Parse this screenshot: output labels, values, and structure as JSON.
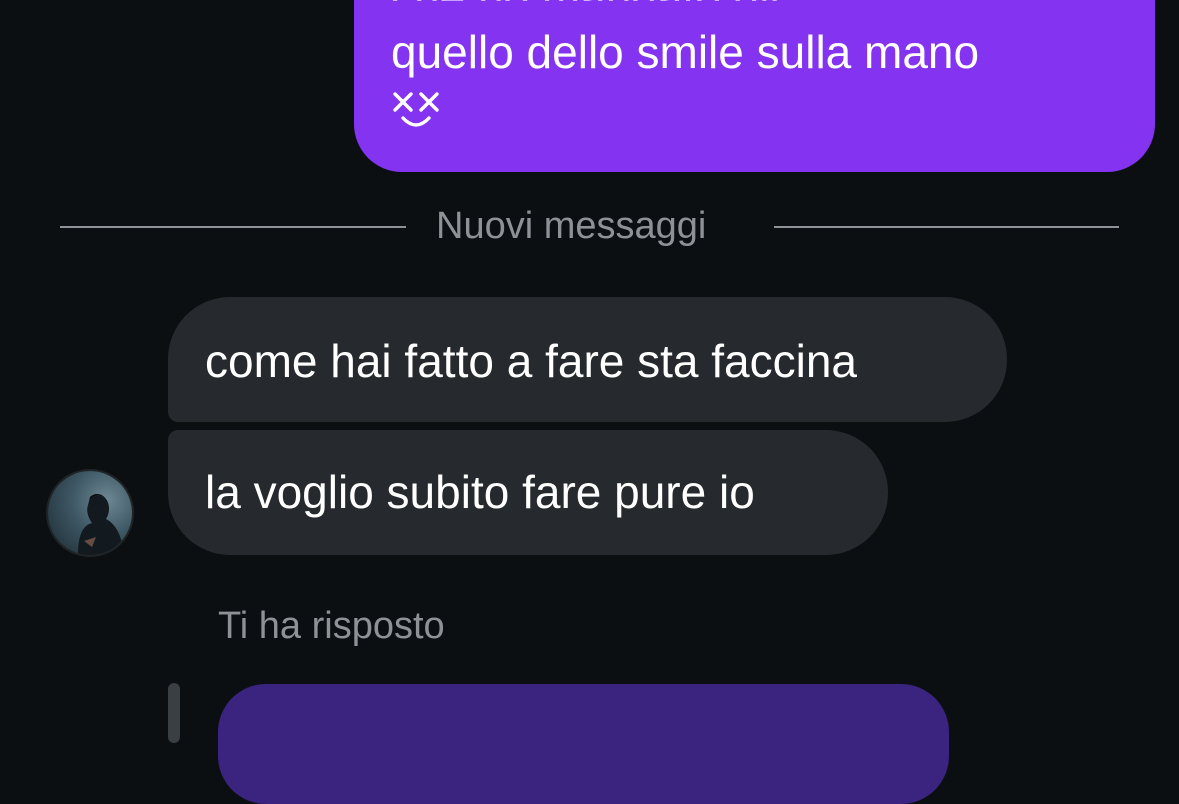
{
  "conversation": {
    "outgoing": {
      "line_partial": "che ho mandato gli",
      "line_main": "quello dello smile sulla mano",
      "face_icon": "xx-smile-face-icon",
      "color": "#8434f0"
    },
    "divider": {
      "label": "Nuovi messaggi"
    },
    "incoming": [
      {
        "text": "come hai fatto a fare sta faccina"
      },
      {
        "text": "la voglio subito fare pure io"
      }
    ],
    "reply": {
      "meta": "Ti ha risposto",
      "bubble_color": "#3b2380"
    }
  }
}
